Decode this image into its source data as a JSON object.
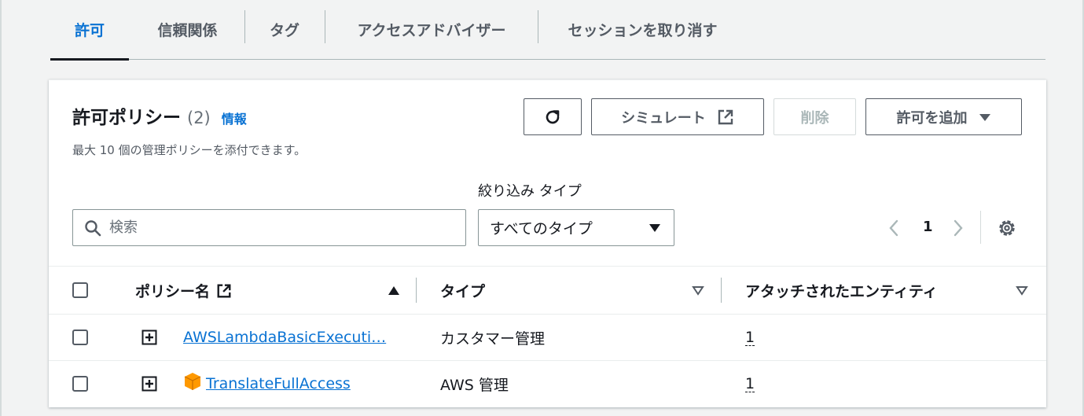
{
  "tabs": [
    {
      "label": "許可",
      "active": true
    },
    {
      "label": "信頼関係",
      "active": false
    },
    {
      "label": "タグ",
      "active": false
    },
    {
      "label": "アクセスアドバイザー",
      "active": false
    },
    {
      "label": "セッションを取り消す",
      "active": false
    }
  ],
  "panel": {
    "title": "許可ポリシー",
    "count": "(2)",
    "info_link": "情報",
    "description": "最大 10 個の管理ポリシーを添付できます。",
    "buttons": {
      "simulate": "シミュレート",
      "delete": "削除",
      "add_permissions": "許可を追加"
    }
  },
  "filter": {
    "search_placeholder": "検索",
    "type_label": "絞り込み タイプ",
    "type_selected": "すべてのタイプ"
  },
  "pagination": {
    "current_page": "1"
  },
  "table": {
    "headers": {
      "policy_name": "ポリシー名",
      "type": "タイプ",
      "attached_entities": "アタッチされたエンティティ"
    },
    "rows": [
      {
        "name": "AWSLambdaBasicExecuti…",
        "type": "カスタマー管理",
        "attached": "1",
        "aws_icon": false
      },
      {
        "name": "TranslateFullAccess",
        "type": "AWS 管理",
        "attached": "1",
        "aws_icon": true
      }
    ]
  },
  "colors": {
    "accent": "#0972d3",
    "text": "#16191f",
    "muted": "#545b64",
    "aws_orange": "#f90"
  }
}
